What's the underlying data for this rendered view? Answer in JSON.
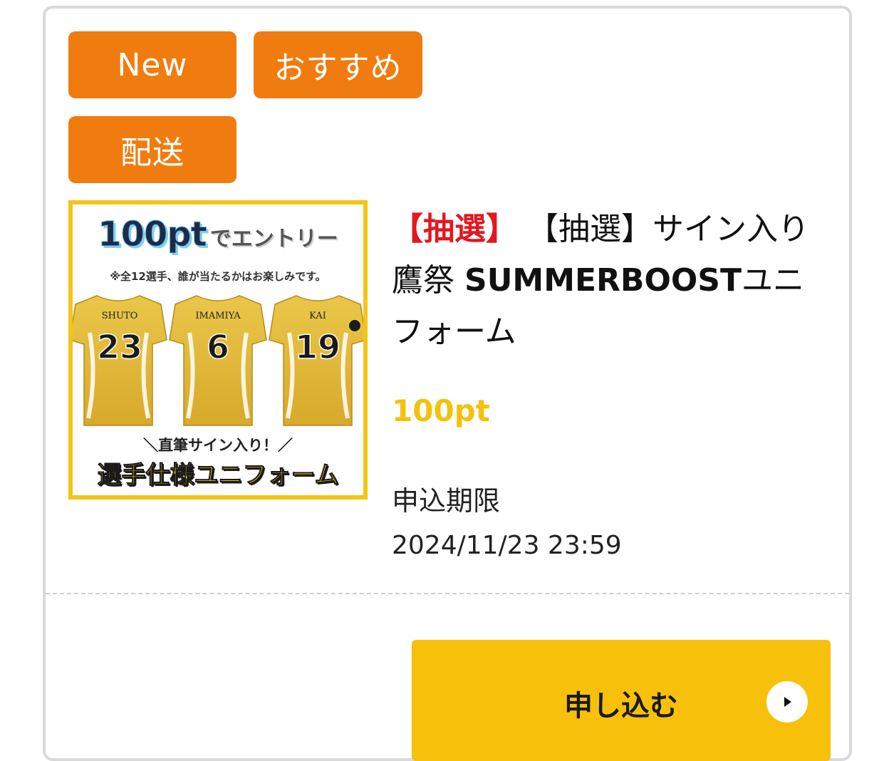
{
  "tags": {
    "new": "New",
    "recommend": "おすすめ",
    "shipping": "配送"
  },
  "thumbnail": {
    "headline_points": "100pt",
    "headline_entry": "でエントリー",
    "note": "※全12選手、誰が当たるかはお楽しみです。",
    "players": [
      {
        "name": "SHUTO",
        "number": "23"
      },
      {
        "name": "IMAMIYA",
        "number": "6"
      },
      {
        "name": "KAI",
        "number": "19"
      }
    ],
    "subline": "＼直筆サイン入り！／",
    "mainline": "選手仕様ユニフォーム"
  },
  "item": {
    "title_prefix": "【抽選】",
    "title_line": "【抽選】サイン入り鷹祭",
    "title_bold": "SUMMERBOOST",
    "title_suffix": "ユニフォーム",
    "points": "100pt",
    "deadline_label": "申込期限",
    "deadline_value": "2024/11/23 23:59"
  },
  "apply_button": {
    "label": "申し込む",
    "icon": "play-arrow-icon"
  },
  "colors": {
    "tag_orange": "#f07c0f",
    "accent_yellow": "#f7c00a",
    "points_yellow": "#f4c10c",
    "lottery_red": "#e4171f"
  }
}
